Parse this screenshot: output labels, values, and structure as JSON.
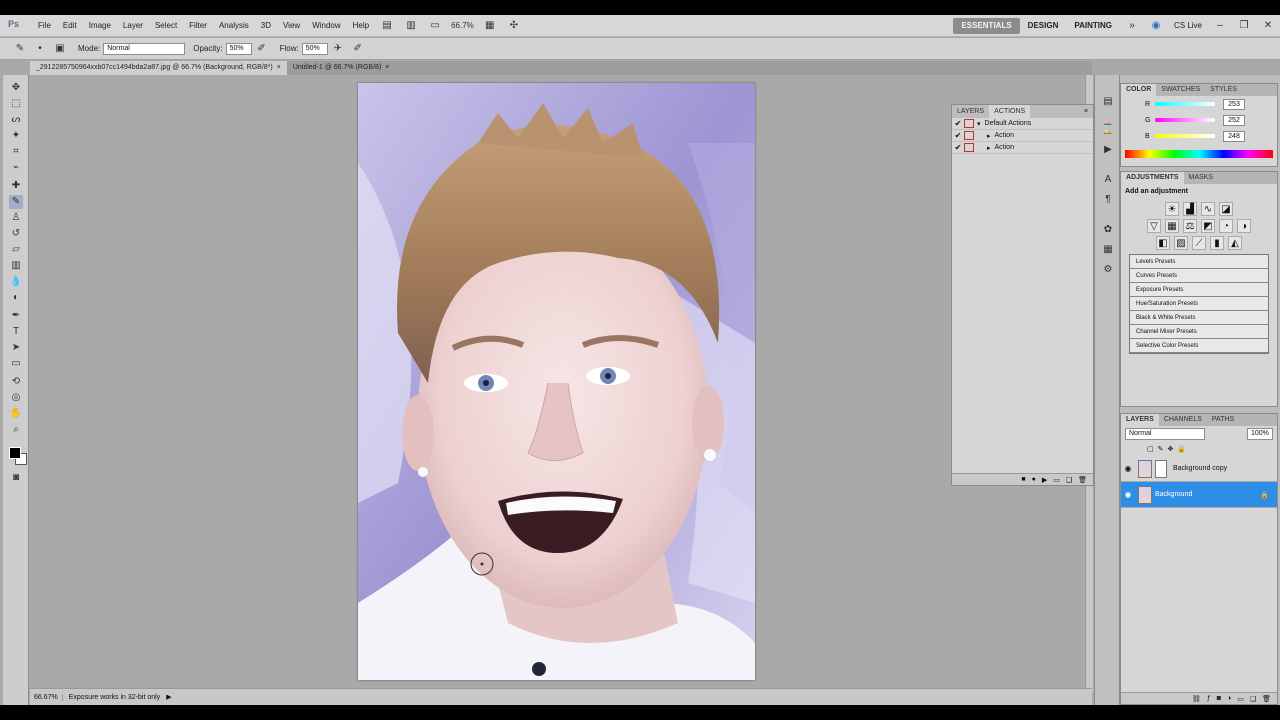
{
  "menubar": {
    "logo": "Ps",
    "items": [
      "File",
      "Edit",
      "Image",
      "Layer",
      "Select",
      "Filter",
      "Analysis",
      "3D",
      "View",
      "Window",
      "Help"
    ],
    "zoom": "66.7%",
    "workspaces": [
      "ESSENTIALS",
      "DESIGN",
      "PAINTING"
    ],
    "search_label": "CS Live"
  },
  "options": {
    "mode_label": "Mode:",
    "mode_value": "Normal",
    "opacity_label": "Opacity:",
    "opacity_value": "50%",
    "flow_label": "Flow:",
    "flow_value": "50%"
  },
  "tabs": [
    {
      "label": "_2912285750964xxb07cc1494bda2a87.jpg @ 66.7% (Background, RGB/8*)",
      "close": "×"
    },
    {
      "label": "Untitled-1 @ 66.7% (RGB/8)",
      "close": "×"
    }
  ],
  "status": {
    "zoom": "66.67%",
    "info": "Exposure works in 32-bit only"
  },
  "paths_panel": {
    "tabs": [
      "LAYERS",
      "ACTIONS"
    ],
    "rows": [
      "Default Actions",
      "Action",
      "Action"
    ]
  },
  "color_panel": {
    "tabs": [
      "COLOR",
      "SWATCHES",
      "STYLES"
    ],
    "channels": [
      {
        "label": "R",
        "value": "253",
        "color": "#2ec8c8"
      },
      {
        "label": "G",
        "value": "252",
        "color": "#e83f9c"
      },
      {
        "label": "B",
        "value": "248",
        "color": "#e0d020"
      }
    ]
  },
  "adjustments_panel": {
    "tabs": [
      "ADJUSTMENTS",
      "MASKS"
    ],
    "title": "Add an adjustment",
    "presets": [
      "Levels Presets",
      "Curves Presets",
      "Exposure Presets",
      "Hue/Saturation Presets",
      "Black & White Presets",
      "Channel Mixer Presets",
      "Selective Color Presets"
    ]
  },
  "layers_panel": {
    "tabs": [
      "LAYERS",
      "CHANNELS",
      "PATHS"
    ],
    "blend_mode": "Normal",
    "opacity": "100%",
    "layers": [
      {
        "name": "Background copy",
        "selected": false
      },
      {
        "name": "Background",
        "selected": true
      }
    ]
  },
  "accent_color": "#2e8ee6"
}
